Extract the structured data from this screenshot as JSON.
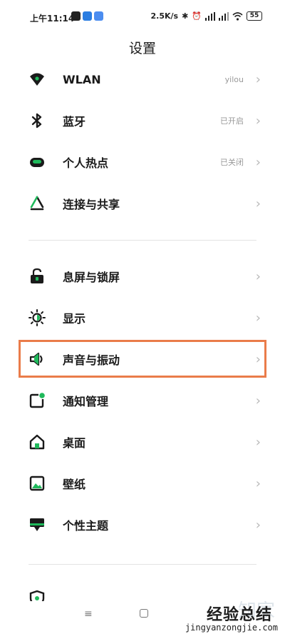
{
  "status_bar": {
    "time": "上午11:14",
    "network_speed": "2.5K/s",
    "battery": "55",
    "icons": [
      "bluetooth-icon",
      "alarm-icon",
      "signal-icon",
      "signal-icon",
      "wifi-icon"
    ]
  },
  "title": "设置",
  "groups": [
    {
      "items": [
        {
          "label": "WLAN",
          "value": "yilou",
          "icon": "wifi-icon"
        },
        {
          "label": "蓝牙",
          "value": "已开启",
          "icon": "bluetooth-icon"
        },
        {
          "label": "个人热点",
          "value": "已关闭",
          "icon": "hotspot-icon"
        },
        {
          "label": "连接与共享",
          "value": "",
          "icon": "share-icon"
        }
      ]
    },
    {
      "items": [
        {
          "label": "息屏与锁屏",
          "value": "",
          "icon": "lock-icon"
        },
        {
          "label": "显示",
          "value": "",
          "icon": "brightness-icon"
        },
        {
          "label": "声音与振动",
          "value": "",
          "icon": "speaker-icon"
        },
        {
          "label": "通知管理",
          "value": "",
          "icon": "notification-icon"
        },
        {
          "label": "桌面",
          "value": "",
          "icon": "home-icon"
        },
        {
          "label": "壁纸",
          "value": "",
          "icon": "wallpaper-icon"
        },
        {
          "label": "个性主题",
          "value": "",
          "icon": "theme-icon"
        }
      ]
    }
  ],
  "highlighted_item": "声音与振动",
  "colors": {
    "accent": "#1fb95b",
    "highlight_border": "#ea7c4a"
  },
  "watermark": {
    "main": "经验总结",
    "url": "jingyanzongjie.com"
  }
}
